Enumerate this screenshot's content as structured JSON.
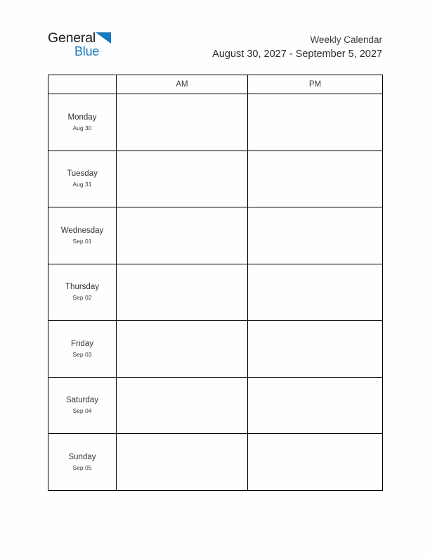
{
  "logo": {
    "text_primary": "General",
    "text_secondary": "Blue",
    "triangle_icon": "blue-triangle-icon",
    "accent_color": "#1878be",
    "primary_color": "#1a1a1a"
  },
  "header": {
    "title": "Weekly Calendar",
    "date_range": "August 30, 2027 - September 5, 2027"
  },
  "table": {
    "columns": [
      {
        "label": "",
        "name": "day-column"
      },
      {
        "label": "AM",
        "name": "am-column"
      },
      {
        "label": "PM",
        "name": "pm-column"
      }
    ],
    "rows": [
      {
        "day": "Monday",
        "date": "Aug 30",
        "am": "",
        "pm": ""
      },
      {
        "day": "Tuesday",
        "date": "Aug 31",
        "am": "",
        "pm": ""
      },
      {
        "day": "Wednesday",
        "date": "Sep 01",
        "am": "",
        "pm": ""
      },
      {
        "day": "Thursday",
        "date": "Sep 02",
        "am": "",
        "pm": ""
      },
      {
        "day": "Friday",
        "date": "Sep 03",
        "am": "",
        "pm": ""
      },
      {
        "day": "Saturday",
        "date": "Sep 04",
        "am": "",
        "pm": ""
      },
      {
        "day": "Sunday",
        "date": "Sep 05",
        "am": "",
        "pm": ""
      }
    ]
  },
  "style": {
    "page_background": "#fefefe",
    "border_color": "#000000"
  }
}
